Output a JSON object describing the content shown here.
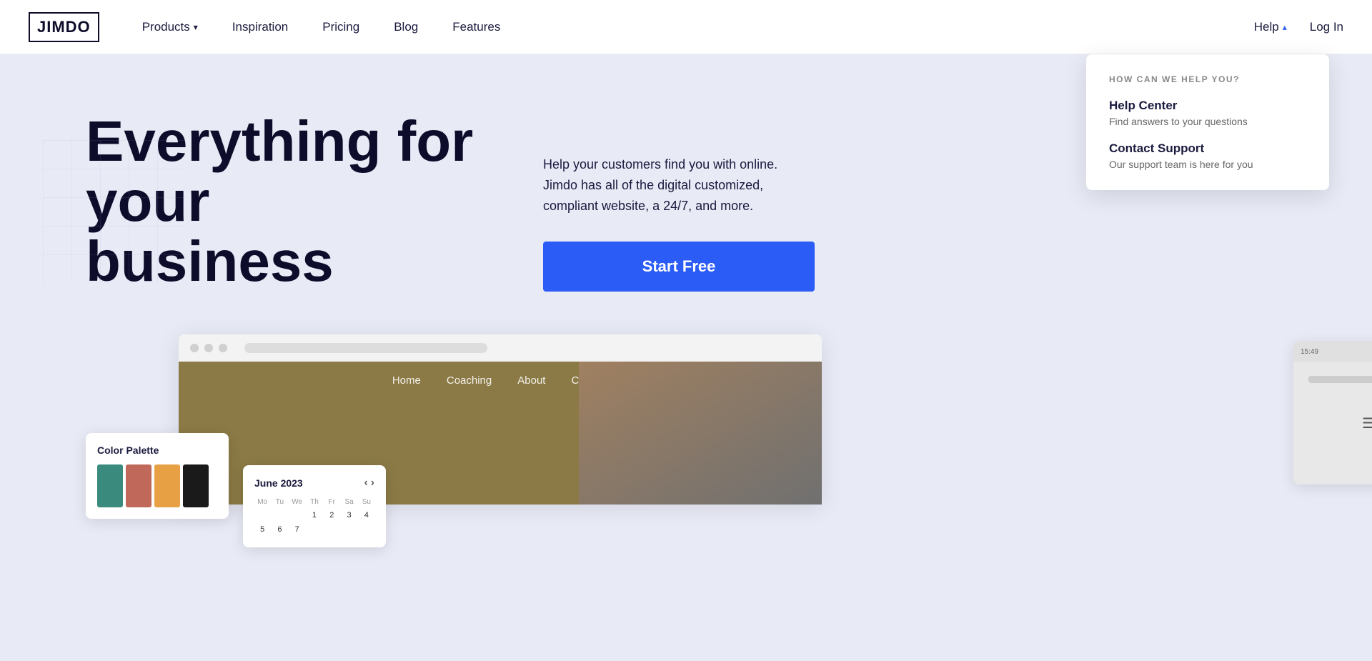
{
  "navbar": {
    "logo": "JIMDO",
    "nav_items": [
      {
        "label": "Products",
        "has_dropdown": true
      },
      {
        "label": "Inspiration",
        "has_dropdown": false
      },
      {
        "label": "Pricing",
        "has_dropdown": false
      },
      {
        "label": "Blog",
        "has_dropdown": false
      },
      {
        "label": "Features",
        "has_dropdown": false
      }
    ],
    "help_label": "Help",
    "login_label": "Log In"
  },
  "help_dropdown": {
    "title": "HOW CAN WE HELP YOU?",
    "items": [
      {
        "title": "Help Center",
        "desc": "Find answers to your questions"
      },
      {
        "title": "Contact Support",
        "desc": "Our support team is here for you"
      }
    ]
  },
  "hero": {
    "heading_line1": "Everything for your",
    "heading_line2": "business",
    "subtext": "Help your customers find you with online. Jimdo has all of the digital customized, compliant website, a 24/7, and more.",
    "cta_label": "Start Free"
  },
  "browser_mockup": {
    "nav_links": [
      "Home",
      "Coaching",
      "About",
      "Contact"
    ]
  },
  "color_palette": {
    "title": "Color Palette",
    "swatches": [
      "#3a8a7e",
      "#c0685a",
      "#e8a045",
      "#1a1a1a"
    ]
  },
  "calendar": {
    "month_year": "June 2023",
    "days_header": [
      "Mo",
      "Tu",
      "We",
      "Th",
      "Fr",
      "Sa",
      "Su"
    ],
    "days": [
      "",
      "",
      "",
      "1",
      "2",
      "3",
      "4",
      "5",
      "6",
      "7"
    ]
  }
}
